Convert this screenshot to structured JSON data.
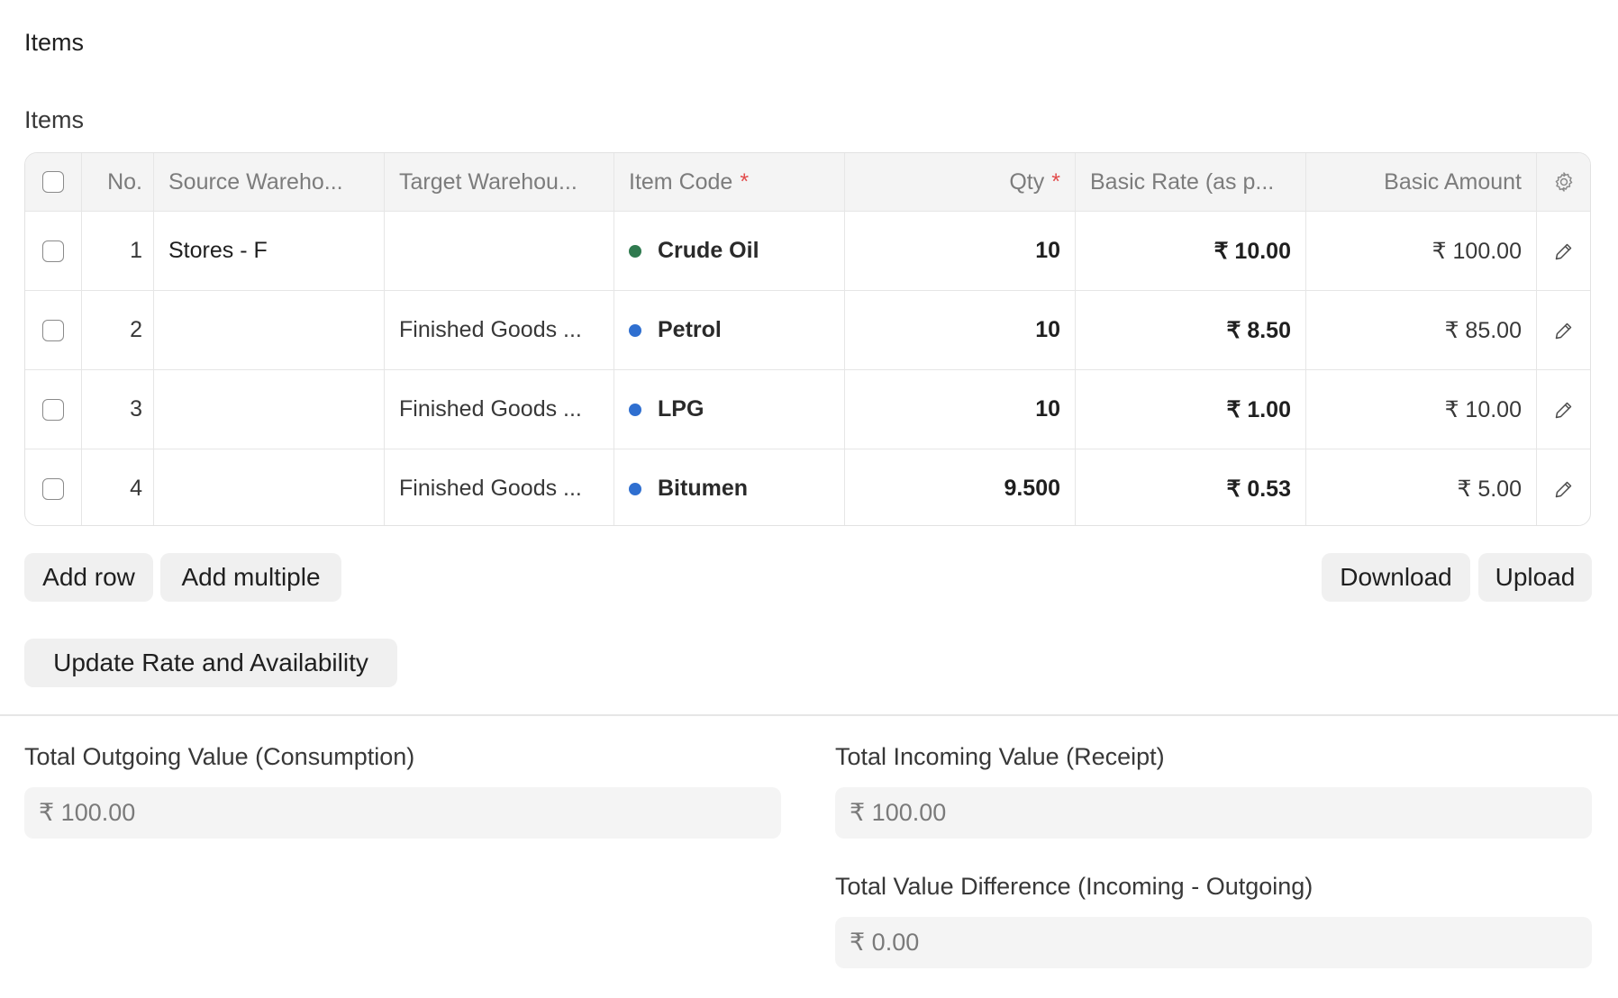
{
  "section": {
    "title": "Items"
  },
  "grid": {
    "label": "Items",
    "headers": {
      "no": "No.",
      "source_warehouse": "Source Wareho...",
      "target_warehouse": "Target Warehou...",
      "item_code": "Item Code",
      "qty": "Qty",
      "basic_rate": "Basic Rate (as p...",
      "basic_amount": "Basic Amount",
      "required_marker": "*"
    },
    "rows": [
      {
        "no": "1",
        "source_warehouse": "Stores - F",
        "target_warehouse": "",
        "item_code": "Crude Oil",
        "qty": "10",
        "basic_rate": "₹ 10.00",
        "basic_amount": "₹ 100.00",
        "status_color": "#2f7a4f"
      },
      {
        "no": "2",
        "source_warehouse": "",
        "target_warehouse": "Finished Goods ...",
        "item_code": "Petrol",
        "qty": "10",
        "basic_rate": "₹ 8.50",
        "basic_amount": "₹ 85.00",
        "status_color": "#2f6fd0"
      },
      {
        "no": "3",
        "source_warehouse": "",
        "target_warehouse": "Finished Goods ...",
        "item_code": "LPG",
        "qty": "10",
        "basic_rate": "₹ 1.00",
        "basic_amount": "₹ 10.00",
        "status_color": "#2f6fd0"
      },
      {
        "no": "4",
        "source_warehouse": "",
        "target_warehouse": "Finished Goods ...",
        "item_code": "Bitumen",
        "qty": "9.500",
        "basic_rate": "₹ 0.53",
        "basic_amount": "₹ 5.00",
        "status_color": "#2f6fd0"
      }
    ],
    "icons": {
      "settings": "gear-icon",
      "edit": "pencil-icon"
    }
  },
  "actions": {
    "add_row": "Add row",
    "add_multiple": "Add multiple",
    "download": "Download",
    "upload": "Upload",
    "update_rate": "Update Rate and Availability"
  },
  "totals": {
    "outgoing_label": "Total Outgoing Value (Consumption)",
    "outgoing_value": "₹ 100.00",
    "incoming_label": "Total Incoming Value (Receipt)",
    "incoming_value": "₹ 100.00",
    "difference_label": "Total Value Difference (Incoming - Outgoing)",
    "difference_value": "₹ 0.00"
  }
}
